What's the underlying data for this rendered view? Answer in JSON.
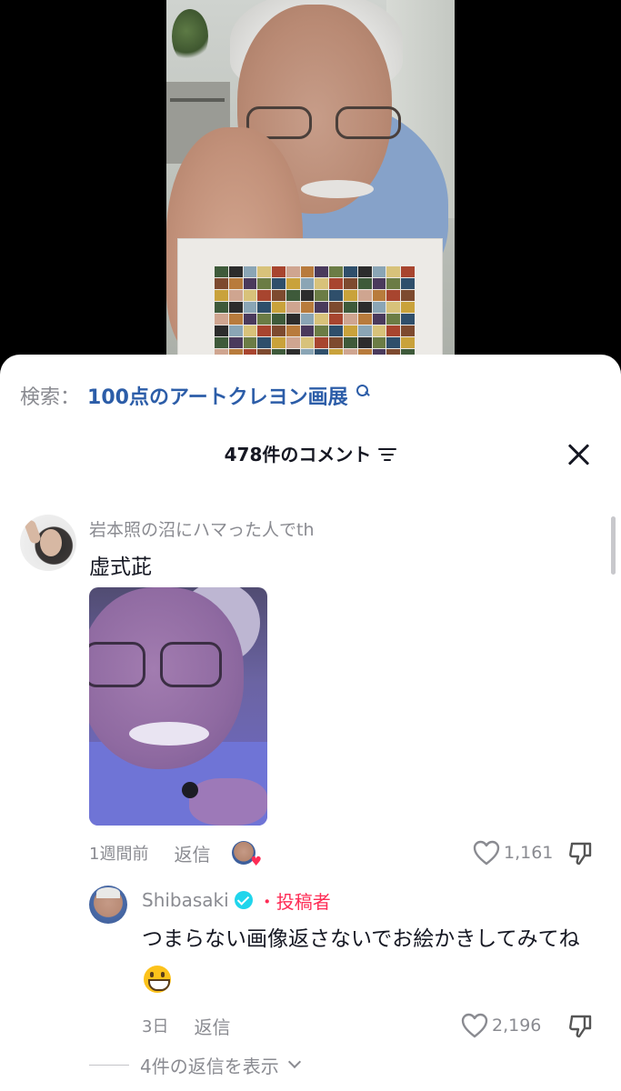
{
  "search": {
    "prefix": "検索：",
    "term": "100点のアートクレヨン画展",
    "icon": "search-icon"
  },
  "comments_panel": {
    "title": "478件のコメント",
    "filter_icon": "filter-icon",
    "close_icon": "close-icon"
  },
  "comments": [
    {
      "username": "岩本照の沼にハマった人でth",
      "text": "虚式茈",
      "has_image": true,
      "time": "1週間前",
      "reply_label": "返信",
      "liked_by_creator": true,
      "likes": "1,161"
    }
  ],
  "replies": [
    {
      "username": "Shibasaki",
      "verified": true,
      "creator_tag": "・投稿者",
      "text": "つまらない画像返さないでお絵かきしてみてね",
      "emoji": "grinning-face",
      "time": "3日",
      "reply_label": "返信",
      "likes": "2,196"
    }
  ],
  "view_replies": {
    "label": "4件の返信を表示"
  },
  "colors": {
    "accent_link": "#2c5da8",
    "creator_red": "#fe2c55",
    "verified_cyan": "#20d5ec",
    "muted_text": "#8a8b91"
  }
}
